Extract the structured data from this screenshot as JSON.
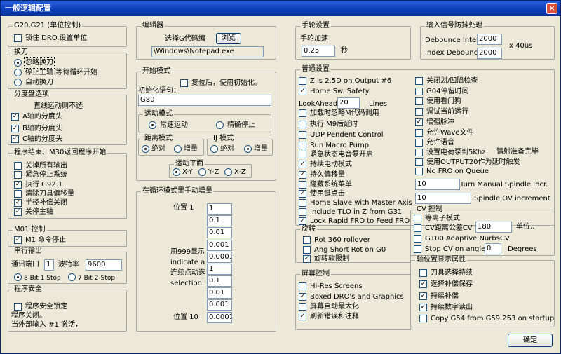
{
  "window": {
    "title": "一般逻辑配置",
    "close_glyph": "×"
  },
  "g20": {
    "title": "G20,G21 (单位控制)",
    "lock_dro": "锁住 DRO.设置单位"
  },
  "tool_change": {
    "title": "换刀",
    "opt_ignore": "忽略换刀",
    "opt_stop": "停止主轴.等待循环开始",
    "opt_auto": "自动换刀"
  },
  "index": {
    "title": "分度盘选项",
    "note": "直线运动则不选",
    "a": "A轴的分度头",
    "b": "B轴的分度头",
    "c": "C轴的分度头"
  },
  "prog_end": {
    "title": "程序结束、M30返回程序开始",
    "items": [
      "关掉所有输出",
      "紧急停止系统",
      "执行 G92.1",
      "清除刀具偏移量",
      "半径补偿关闭",
      "关停主轴"
    ]
  },
  "m01": {
    "title": "M01 控制",
    "m1": "M1 命令停止"
  },
  "serial": {
    "title": "串行输出",
    "port_label": "通讯端口",
    "port": "1",
    "baud_label": "波特率",
    "baud": "9600",
    "bit8": "8-Bit 1 Stop",
    "bit7": "7 Bit 2-Stop"
  },
  "safety": {
    "title": "程序安全",
    "lock": "程序安全锁定",
    "line1": "程序关闭。",
    "line2": "当外部输入 #1 激活，"
  },
  "editor": {
    "title": "编辑器",
    "choose": "选择G代码编",
    "browse": "浏览",
    "path": "\\Windows\\Notepad.exe"
  },
  "init": {
    "title": "开始模式",
    "reset": "复位后，使用初始化。",
    "label": "初始化语句：",
    "value": "G80"
  },
  "motion": {
    "title": "运动模式",
    "constant": "常速运动",
    "exact": "精确停止"
  },
  "dist": {
    "title": "距离模式",
    "abs": "绝对",
    "inc": "增量"
  },
  "ij": {
    "title": "IJ 模式",
    "abs": "绝对",
    "inc": "增量"
  },
  "plane": {
    "title": "运动平面",
    "xy": "X-Y",
    "yz": "Y-Z",
    "xz": "X-Z"
  },
  "cycle": {
    "title": "在循环模式里手动增量",
    "pos1": "位置 1",
    "pos10": "位置 10",
    "note": [
      "用999显示",
      "indicate a",
      "连续点动选",
      "selection."
    ],
    "values": [
      "1",
      "0.1",
      "0.01",
      "0.001",
      "0.0001",
      "1",
      "0.1",
      "0.01",
      "0.001",
      "0.0001"
    ]
  },
  "mpg": {
    "title": "手轮设置",
    "accel_label": "手轮加速",
    "accel": "0.25",
    "unit": "秒"
  },
  "debounce": {
    "title": "输入信号防抖处理",
    "interval_label": "Debounce Interval",
    "interval": "2000",
    "index_label": "Index Debounce",
    "index": "2000",
    "unit": "x 40us"
  },
  "general": {
    "title": "普通设置",
    "z25": "Z is 2.5D on Output #6",
    "home_safety": "Home Sw. Safety",
    "lookahead_label": "LookAhead",
    "lookahead": "20",
    "lines": "Lines",
    "ignore_m": "加载时忽略M代码调用",
    "m9": "执行 M9后延时",
    "udp": "UDP Pendent Control",
    "macro_pump": "Run Macro Pump",
    "estop_pump": "紧急状态电音泵开启",
    "persist_motion": "持续电动模式",
    "persist_offset": "持久偏移量",
    "hide_menu": "隐藏系统菜单",
    "use_key": "使用键点击",
    "home_slave": "Home Slave with Master Axis",
    "tlo": "Include TLO in Z from G31",
    "lock_rapid": "Lock Rapid FRO to Feed FRO",
    "arc": "关闭划/凹陷检查",
    "g04": "G04停留时间",
    "watchdog": "使用看门狗",
    "debug": "调试当前运行",
    "pulse": "增强脉冲",
    "allow_wave": "允许Wave文件",
    "allow_voice": "允许语音",
    "charge_pump": "设置电荷泵到5Khz",
    "out20": "使用OUTPUT20作为延时触发",
    "ready": "镭射准备完毕",
    "no_fro": "No FRO on Queue",
    "spindle_incr_val": "10",
    "spindle_incr": "Turn Manual Spindle Incr.",
    "spindle_ov_val": "10",
    "spindle_ov": "Spindle OV increment"
  },
  "rotation": {
    "title": "旋转",
    "rot360": "Rot 360 rollover",
    "ang_short": "Ang Short Rot on G0",
    "soft_limit": "旋转软限制"
  },
  "screen": {
    "title": "屏幕控制",
    "hires": "Hi-Res Screens",
    "boxed": "Boxed DRO's and Graphics",
    "auto_max": "屏幕自动最大化",
    "refresh": "刷新错误和注释"
  },
  "cv": {
    "title": "CV 控制",
    "plasma": "等离子模式",
    "dist_label": "CV距离公差CV",
    "dist": "180",
    "unit": "单位..",
    "g100": "G100 Adaptive NurbsCV",
    "stop_label": "Stop CV on angles >",
    "stop": "0",
    "degrees": "Degrees"
  },
  "axis": {
    "title": "轴位置显示属性",
    "tool_select": "刀具选择持续",
    "comp_save": "选择补偿保存",
    "persist_comp": "持续补偿",
    "persist_read": "持续数字读出",
    "copy_g54": "Copy G54 from G59.253 on startup"
  },
  "ok": "确定"
}
